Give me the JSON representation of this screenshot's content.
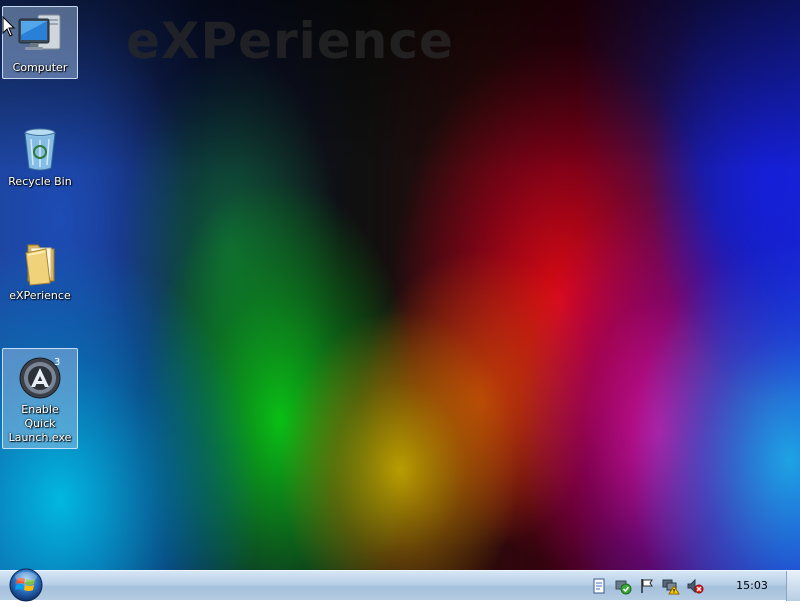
{
  "desktop": {
    "watermark": "eXPerience",
    "icons": [
      {
        "label": "Computer",
        "icon": "computer-icon",
        "selected": true
      },
      {
        "label": "Recycle Bin",
        "icon": "recycle-bin-icon",
        "selected": false
      },
      {
        "label": "eXPerience",
        "icon": "folder-icon",
        "selected": false
      },
      {
        "label": "Enable Quick Launch.exe",
        "icon": "quick-launch-icon",
        "selected": true
      }
    ]
  },
  "taskbar": {
    "start_icon": "windows-orb-icon",
    "tray_icons": [
      "document-icon",
      "security-check-icon",
      "action-center-flag-icon",
      "network-warning-icon",
      "volume-muted-icon"
    ],
    "clock": "15:03"
  },
  "colors": {
    "taskbar": "#b8d0e8",
    "selection": "#aac8eb"
  }
}
